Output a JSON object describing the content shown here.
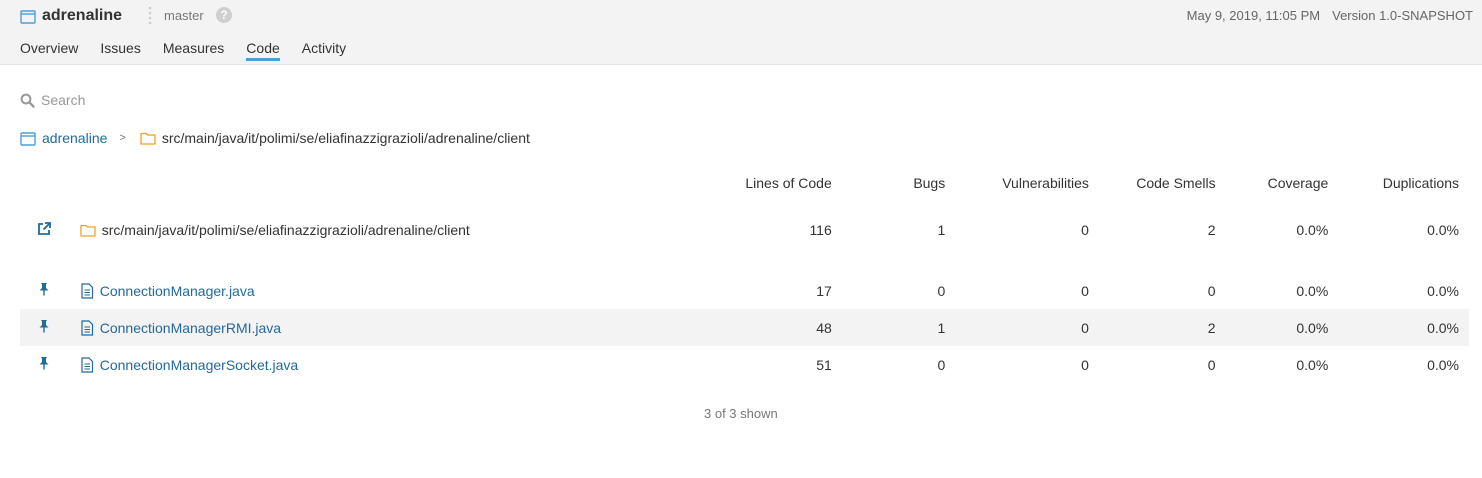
{
  "project": {
    "name": "adrenaline",
    "branch": "master",
    "help_symbol": "?",
    "date": "May 9, 2019, 11:05 PM",
    "version": "Version 1.0-SNAPSHOT"
  },
  "tabs": [
    {
      "label": "Overview",
      "active": false
    },
    {
      "label": "Issues",
      "active": false
    },
    {
      "label": "Measures",
      "active": false
    },
    {
      "label": "Code",
      "active": true
    },
    {
      "label": "Activity",
      "active": false
    }
  ],
  "search": {
    "placeholder": "Search"
  },
  "breadcrumb": {
    "root": "adrenaline",
    "separator": ">",
    "path": "src/main/java/it/polimi/se/eliafinazzigrazioli/adrenaline/client"
  },
  "table": {
    "columns": [
      "Lines of Code",
      "Bugs",
      "Vulnerabilities",
      "Code Smells",
      "Coverage",
      "Duplications"
    ],
    "base_row": {
      "name": "src/main/java/it/polimi/se/eliafinazzigrazioli/adrenaline/client",
      "values": [
        "116",
        "1",
        "0",
        "2",
        "0.0%",
        "0.0%"
      ]
    },
    "rows": [
      {
        "name": "ConnectionManager.java",
        "values": [
          "17",
          "0",
          "0",
          "0",
          "0.0%",
          "0.0%"
        ]
      },
      {
        "name": "ConnectionManagerRMI.java",
        "values": [
          "48",
          "1",
          "0",
          "2",
          "0.0%",
          "0.0%"
        ]
      },
      {
        "name": "ConnectionManagerSocket.java",
        "values": [
          "51",
          "0",
          "0",
          "0",
          "0.0%",
          "0.0%"
        ]
      }
    ]
  },
  "footer": {
    "shown": "3 of 3 shown"
  },
  "colors": {
    "link": "#236a97",
    "tab_active": "#4b9fd5",
    "folder": "#f0a020",
    "topbar": "#f3f3f3"
  }
}
